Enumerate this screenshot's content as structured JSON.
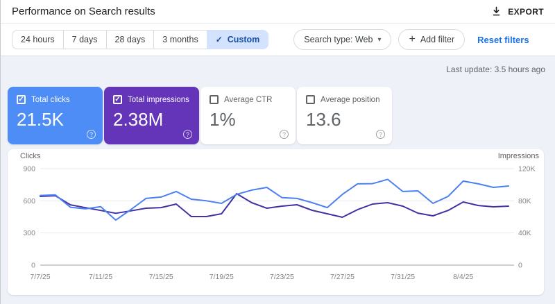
{
  "header": {
    "title": "Performance on Search results",
    "export_label": "EXPORT",
    "export_icon": "download-icon"
  },
  "toolbar": {
    "ranges": [
      "24 hours",
      "7 days",
      "28 days",
      "3 months",
      "Custom"
    ],
    "selected_range": "Custom",
    "selected_check": "✓",
    "search_type_label": "Search type: Web",
    "search_type_caret": "▾",
    "add_filter_plus": "+",
    "add_filter_label": "Add filter",
    "reset_label": "Reset filters"
  },
  "status": {
    "last_update": "Last update: 3.5 hours ago"
  },
  "metric_cards": [
    {
      "label": "Total clicks",
      "value": "21.5K",
      "checked": true,
      "bg": "#4d8df5",
      "check": "✓",
      "help": "?"
    },
    {
      "label": "Total impressions",
      "value": "2.38M",
      "checked": true,
      "bg": "#6435b9",
      "check": "✓",
      "help": "?"
    },
    {
      "label": "Average CTR",
      "value": "1%",
      "checked": false,
      "bg": null,
      "check": "✓",
      "help": "?"
    },
    {
      "label": "Average position",
      "value": "13.6",
      "checked": false,
      "bg": null,
      "check": "✓",
      "help": "?"
    }
  ],
  "chart_data": {
    "type": "line",
    "title": "",
    "x": [
      "7/7/25",
      "7/8/25",
      "7/9/25",
      "7/10/25",
      "7/11/25",
      "7/12/25",
      "7/13/25",
      "7/14/25",
      "7/15/25",
      "7/16/25",
      "7/17/25",
      "7/18/25",
      "7/19/25",
      "7/20/25",
      "7/21/25",
      "7/22/25",
      "7/23/25",
      "7/24/25",
      "7/25/25",
      "7/26/25",
      "7/27/25",
      "7/28/25",
      "7/29/25",
      "7/30/25",
      "7/31/25",
      "8/1/25",
      "8/2/25",
      "8/3/25",
      "8/4/25",
      "8/5/25",
      "8/6/25",
      "8/7/25"
    ],
    "x_tick_indices": [
      0,
      4,
      8,
      12,
      16,
      20,
      24,
      28
    ],
    "x_tick_labels": [
      "7/7/25",
      "7/11/25",
      "7/15/25",
      "7/19/25",
      "7/23/25",
      "7/27/25",
      "7/31/25",
      "8/4/25"
    ],
    "series": [
      {
        "name": "Total clicks",
        "axis": "left",
        "color": "#4c80f1",
        "values": [
          650,
          655,
          540,
          525,
          545,
          420,
          518,
          622,
          635,
          687,
          615,
          600,
          576,
          660,
          700,
          725,
          630,
          622,
          583,
          537,
          660,
          758,
          760,
          800,
          687,
          693,
          576,
          641,
          784,
          758,
          725,
          738
        ]
      },
      {
        "name": "Total impressions",
        "axis": "right",
        "color": "#4330a3",
        "values": [
          85500,
          86300,
          75000,
          71500,
          68000,
          64500,
          67500,
          70800,
          71600,
          76000,
          60400,
          60400,
          63900,
          88900,
          77700,
          70800,
          73400,
          75100,
          68200,
          63900,
          59600,
          69000,
          76000,
          77700,
          73400,
          64700,
          61300,
          68000,
          78600,
          74200,
          72500,
          73400
        ]
      }
    ],
    "left_axis": {
      "label": "Clicks",
      "max": 900,
      "ticks": [
        0,
        300,
        600,
        900
      ],
      "tick_labels": [
        "0",
        "300",
        "600",
        "900"
      ]
    },
    "right_axis": {
      "label": "Impressions",
      "max": 120000,
      "ticks": [
        0,
        40000,
        80000,
        120000
      ],
      "tick_labels": [
        "0",
        "40K",
        "80K",
        "120K"
      ]
    },
    "grid": true,
    "legend": "none",
    "colors": {
      "grid_line": "#e8eaed",
      "baseline": "#9aa0a6",
      "tick_text": "#80868b",
      "axis_title_text": "#5f6368"
    }
  }
}
